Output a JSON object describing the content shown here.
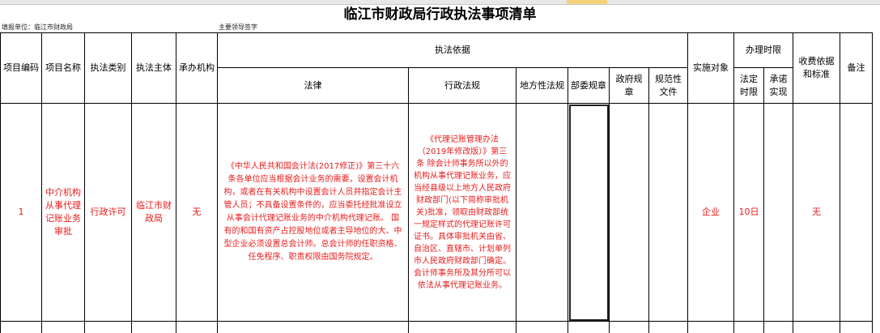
{
  "sheet": {
    "title": "临江市财政局行政执法事项清单",
    "fill_unit": "填报单位：临江市财政局",
    "leader_sign": "主要领导签字"
  },
  "headers": {
    "item_code": "项目编码",
    "item_name": "项目名称",
    "enforcement_type": "执法类别",
    "enforcement_subject": "执法主体",
    "undertaking_org": "承办机构",
    "basis": "执法依据",
    "law": "法律",
    "admin_regulation": "行政法规",
    "local_regulation": "地方性法规",
    "dept_rule": "部委规章",
    "gov_rule": "政府规章",
    "normative_doc": "规范性文件",
    "target": "实施对象",
    "time_limit": "办理时限",
    "statutory_limit": "法定时限",
    "promised_limit": "承诺实现",
    "fee_basis": "收费依据和标准",
    "remarks": "备注"
  },
  "row": {
    "code": "1",
    "name": "中介机构从事代理记账业务审批",
    "type": "行政许可",
    "subject": "临江市财政局",
    "org": "无",
    "law": "《中华人民共和国会计法(2017修正)》第三十六条各单位应当根据会计业务的需要，设置会计机构，或者在有关机构中设置会计人员并指定会计主管人员；不具备设置条件的，应当委托经批准设立从事会计代理记账业务的中介机构代理记账。 国有的和国有资产占控股地位或者主导地位的大、中型企业必须设置总会计师。总会计师的任职资格、任免程序、职责权限由国务院规定。",
    "admin_regulation": "《代理记账管理办法（2019年修改版）》第三条 除会计师事务所以外的机构从事代理记账业务，应当经县级以上地方人民政府财政部门(以下简称审批机关)批准，领取由财政部统一规定样式的代理记账许可证书。具体审批机关由省、自治区、直辖市、计划单列市人民政府财政部门确定。会计师事务所及其分所可以依法从事代理记账业务。",
    "local_regulation": "",
    "dept_rule": "",
    "gov_rule": "",
    "normative_doc": "",
    "target": "企业",
    "statutory_limit": "10日",
    "promised_limit": "",
    "fee": "无",
    "remarks": ""
  },
  "colors": {
    "accent_text": "#e81c1c",
    "grid": "#000000"
  }
}
